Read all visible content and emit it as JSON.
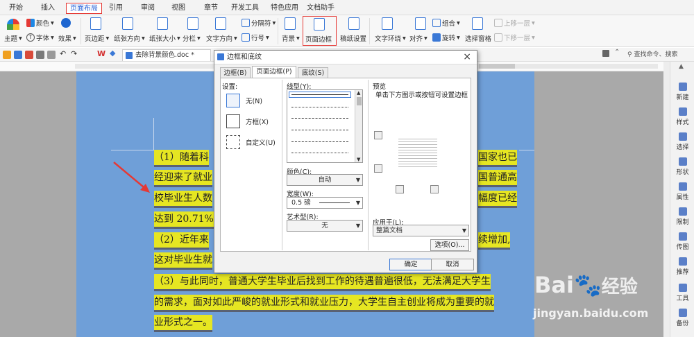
{
  "menu_tabs": [
    "开始",
    "插入",
    "页面布局",
    "引用",
    "审阅",
    "视图",
    "章节",
    "开发工具",
    "特色应用",
    "文档助手"
  ],
  "ribbon": {
    "theme": "主题",
    "color": "颜色",
    "font": "字体",
    "effect": "效果",
    "margins": "页边距",
    "orientation": "纸张方向",
    "size": "纸张大小",
    "columns": "分栏",
    "text_direction": "文字方向",
    "breaks": "分隔符",
    "line_numbers": "行号",
    "background": "背景",
    "page_border": "页面边框",
    "paper_setup": "稿纸设置",
    "text_wrap": "文字环绕",
    "align": "对齐",
    "group": "组合",
    "rotate": "旋转",
    "selection_pane": "选择窗格",
    "bring_forward": "上移一层",
    "send_backward": "下移一层"
  },
  "toolbar": {
    "doc_name": "去除背景颜色.doc *",
    "search_placeholder": "查找命令、搜索"
  },
  "document": {
    "lines": [
      "（1）随着科",
      "经迎来了就业",
      "校毕业生人数",
      "达到 20.71%,",
      "（2）近年来",
      "这对毕业生就",
      "（3）与此同时，普通大学生毕业后找到工作的待遇普遍很低，无法满足大学生",
      "的需求，面对如此严峻的就业形式和就业压力，大学生自主创业将成为重要的就",
      "业形式之一。"
    ],
    "right_fragments": [
      "国家也已",
      "国普通高",
      "幅度已经",
      "续增加,"
    ]
  },
  "right_panel": [
    "新建",
    "样式",
    "选择",
    "形状",
    "属性",
    "限制",
    "传图",
    "推荐",
    "工具",
    "备份"
  ],
  "dialog": {
    "title": "边框和底纹",
    "close": "×",
    "tabs": [
      "边框(B)",
      "页面边框(P)",
      "底纹(S)"
    ],
    "settings_label": "设置:",
    "settings": [
      "无(N)",
      "方框(X)",
      "自定义(U)"
    ],
    "line_style_label": "线型(Y):",
    "color_label": "颜色(C):",
    "color_value": "自动",
    "width_label": "宽度(W):",
    "width_value": "0.5  磅",
    "art_label": "艺术型(R):",
    "art_value": "无",
    "preview_label": "预览",
    "preview_hint": "单击下方图示或按钮可设置边框",
    "apply_label": "应用于(L):",
    "apply_value": "整篇文档",
    "options": "选项(O)...",
    "ok": "确定",
    "cancel": "取消"
  },
  "watermark": {
    "brand": "Bai",
    "brand2": "经验",
    "url": "jingyan.baidu.com"
  },
  "colors": {
    "accent": "#2b64d8",
    "highlight": "#e6e622",
    "page_blue": "#6f9fd8",
    "arrow_red": "#e53935"
  }
}
